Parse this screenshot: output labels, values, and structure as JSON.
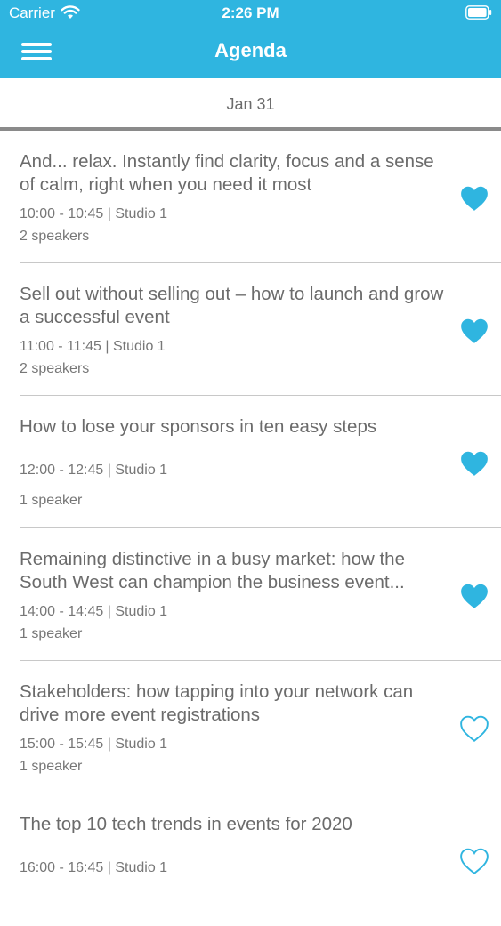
{
  "status": {
    "carrier": "Carrier",
    "time": "2:26 PM"
  },
  "nav": {
    "title": "Agenda"
  },
  "date": {
    "label": "Jan 31"
  },
  "colors": {
    "accent": "#2fb5e0"
  },
  "sessions": [
    {
      "title": "And... relax. Instantly find clarity, focus and a sense of calm, right when you need it most",
      "time": "10:00 - 10:45 | Studio 1",
      "speakers": "2 speakers",
      "favorite": true
    },
    {
      "title": "Sell out without selling out – how to launch and grow a successful event",
      "time": "11:00 - 11:45 | Studio 1",
      "speakers": "2 speakers",
      "favorite": true
    },
    {
      "title": "How to lose your sponsors in ten easy steps",
      "time": "12:00 - 12:45 | Studio 1",
      "speakers": "1 speaker",
      "favorite": true
    },
    {
      "title": "Remaining distinctive in a busy market: how the South West can champion the business event...",
      "time": "14:00 - 14:45 | Studio 1",
      "speakers": "1 speaker",
      "favorite": true
    },
    {
      "title": "Stakeholders: how tapping into your network can drive more event registrations",
      "time": "15:00 - 15:45 | Studio 1",
      "speakers": "1 speaker",
      "favorite": false
    },
    {
      "title": "The top 10 tech trends in events for 2020",
      "time": "16:00 - 16:45 | Studio 1",
      "speakers": "",
      "favorite": false
    }
  ]
}
